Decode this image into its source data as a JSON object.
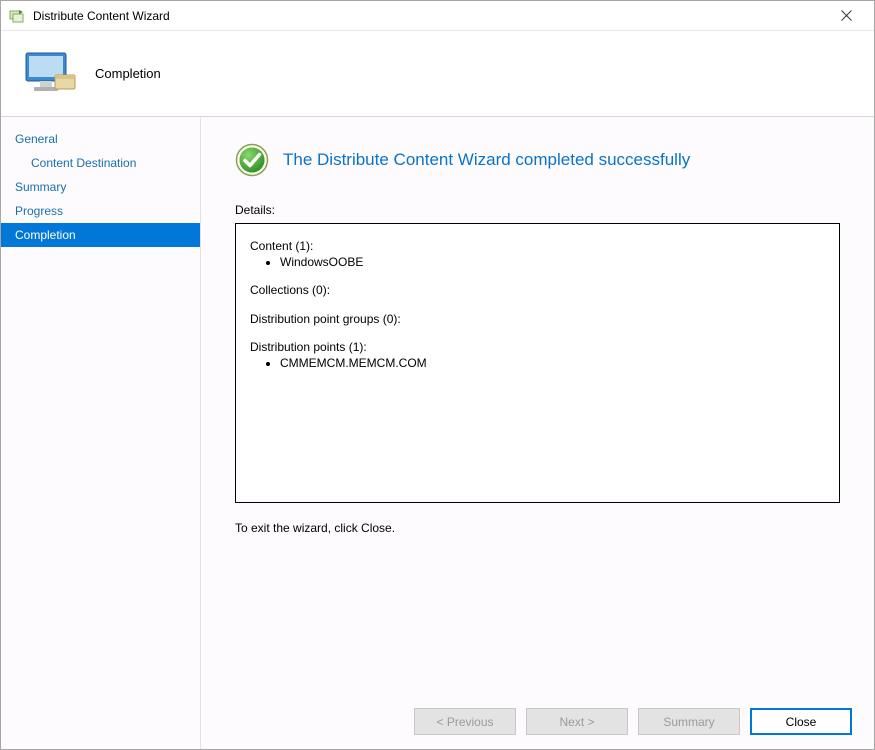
{
  "window": {
    "title": "Distribute Content Wizard"
  },
  "header": {
    "title": "Completion"
  },
  "sidebar": {
    "items": [
      {
        "label": "General",
        "indent": false,
        "selected": false
      },
      {
        "label": "Content Destination",
        "indent": true,
        "selected": false
      },
      {
        "label": "Summary",
        "indent": false,
        "selected": false
      },
      {
        "label": "Progress",
        "indent": false,
        "selected": false
      },
      {
        "label": "Completion",
        "indent": false,
        "selected": true
      }
    ]
  },
  "main": {
    "status_message": "The Distribute Content Wizard completed successfully",
    "details_label": "Details:",
    "details": {
      "content": {
        "heading": "Content (1):",
        "items": [
          "WindowsOOBE"
        ]
      },
      "collections": {
        "heading": "Collections (0):",
        "items": []
      },
      "dp_groups": {
        "heading": "Distribution point groups (0):",
        "items": []
      },
      "dp": {
        "heading": "Distribution points (1):",
        "items": [
          "CMMEMCM.MEMCM.COM"
        ]
      }
    },
    "exit_text": "To exit the wizard, click Close."
  },
  "buttons": {
    "previous": "< Previous",
    "next": "Next >",
    "summary": "Summary",
    "close": "Close"
  }
}
